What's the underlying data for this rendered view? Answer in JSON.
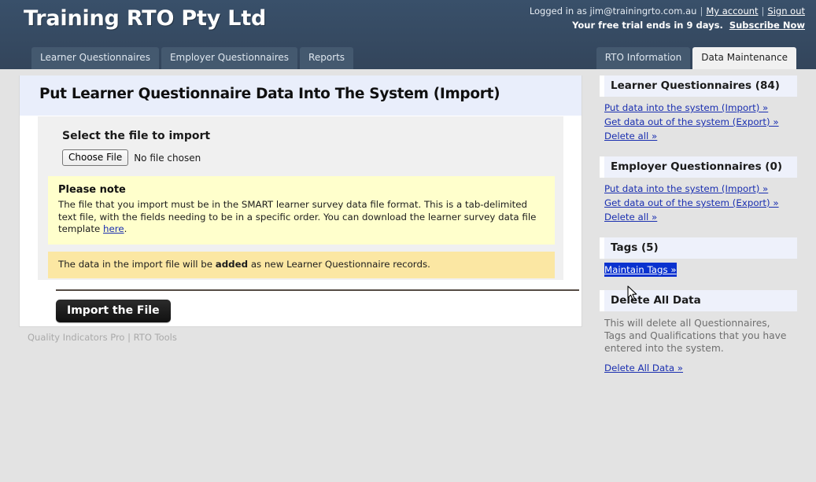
{
  "header": {
    "brand": "Training RTO Pty Ltd",
    "logged_in_prefix": "Logged in as ",
    "logged_in_email": "jim@trainingrto.com.au",
    "my_account_label": "My account",
    "sign_out_label": "Sign out",
    "trial_text": "Your free trial ends in 9 days.",
    "subscribe_label": "Subscribe Now",
    "separator": "|"
  },
  "tabs": {
    "left": [
      {
        "label": "Learner Questionnaires",
        "active": false
      },
      {
        "label": "Employer Questionnaires",
        "active": false
      },
      {
        "label": "Reports",
        "active": false
      }
    ],
    "right": [
      {
        "label": "RTO Information",
        "active": false
      },
      {
        "label": "Data Maintenance",
        "active": true
      }
    ]
  },
  "main": {
    "page_title": "Put Learner Questionnaire Data Into The System (Import)",
    "select_file_label": "Select the file to import",
    "choose_file_button": "Choose File",
    "no_file_chosen": "No file chosen",
    "note": {
      "title": "Please note",
      "body_part1": "The file that you import must be in the SMART learner survey data file format. This is a tab-delimited text file, with the fields needing to be in a specific order. You can download the learner survey data file template ",
      "link_label": "here",
      "body_part2": "."
    },
    "note2": {
      "part1": "The data in the import file will be ",
      "emphasis": "added",
      "part2": " as new Learner Questionnaire records."
    },
    "import_button": "Import the File",
    "footer": "Quality Indicators Pro | RTO Tools"
  },
  "sidebar": {
    "panels": [
      {
        "title": "Learner Questionnaires (84)",
        "links": [
          {
            "label": "Put data into the system (Import) »",
            "selected": false
          },
          {
            "label": "Get data out of the system (Export) »",
            "selected": false
          },
          {
            "label": "Delete all »",
            "selected": false
          }
        ]
      },
      {
        "title": "Employer Questionnaires (0)",
        "links": [
          {
            "label": "Put data into the system (Import) »",
            "selected": false
          },
          {
            "label": "Get data out of the system (Export) »",
            "selected": false
          },
          {
            "label": "Delete all »",
            "selected": false
          }
        ]
      },
      {
        "title": "Tags (5)",
        "links": [
          {
            "label": "Maintain Tags »",
            "selected": true
          }
        ]
      },
      {
        "title": "Delete All Data",
        "description": "This will delete all Questionnaires, Tags and Qualifications that you have entered into the system.",
        "links": [
          {
            "label": "Delete All Data »",
            "selected": false
          }
        ]
      }
    ]
  },
  "colors": {
    "header_bg": "#36495f",
    "page_bg": "#e3e3e3",
    "heading_bg": "#e9eefb",
    "panel_header_bg": "#eef1fb",
    "link": "#1a2fb0",
    "note_bg": "#ffffcc",
    "note2_bg": "#fbe7a3",
    "selection_bg": "#0a32cf",
    "button_bg": "#1a1a1a"
  }
}
